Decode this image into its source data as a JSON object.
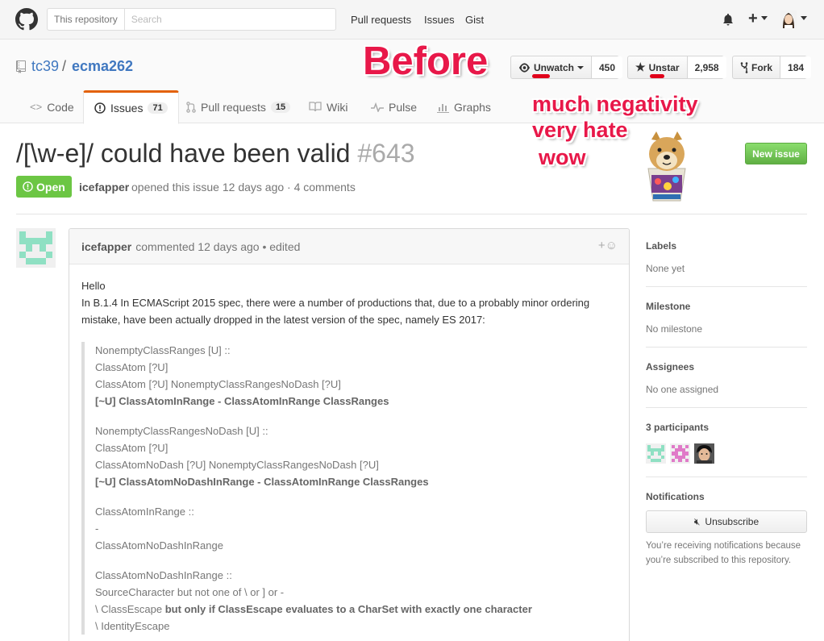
{
  "header": {
    "search_scope": "This repository",
    "search_placeholder": "Search",
    "nav": [
      "Pull requests",
      "Issues",
      "Gist"
    ]
  },
  "repo": {
    "owner": "tc39",
    "sep": "/",
    "name": "ecma262",
    "watch_label": "Unwatch",
    "watch_count": "450",
    "star_label": "Unstar",
    "star_count": "2,958",
    "fork_label": "Fork",
    "fork_count": "184"
  },
  "tabs": [
    {
      "label": "Code"
    },
    {
      "label": "Issues",
      "count": "71"
    },
    {
      "label": "Pull requests",
      "count": "15"
    },
    {
      "label": "Wiki"
    },
    {
      "label": "Pulse"
    },
    {
      "label": "Graphs"
    }
  ],
  "meme": {
    "before": "Before",
    "line1": "much negativity",
    "line2": "very hate",
    "line3": "wow"
  },
  "issue": {
    "title": "/[\\w-e]/ could have been valid",
    "number": "#643",
    "state": "Open",
    "author": "icefapper",
    "meta": "opened this issue 12 days ago · 4 comments",
    "new_issue": "New issue"
  },
  "comment": {
    "author": "icefapper",
    "meta": "commented 12 days ago • edited",
    "hello": "Hello",
    "intro": "In B.1.4 In ECMAScript 2015 spec, there were a number of productions that, due to a probably minor ordering mistake, have been actually dropped in the latest version of the spec, namely ES 2017:",
    "blocks": [
      {
        "lines": [
          "NonemptyClassRanges [U] ::",
          "ClassAtom [?U]",
          "ClassAtom [?U] NonemptyClassRangesNoDash [?U]"
        ],
        "bold": "[~U] ClassAtomInRange - ClassAtomInRange ClassRanges"
      },
      {
        "lines": [
          "NonemptyClassRangesNoDash [U] ::",
          "ClassAtom [?U]",
          "ClassAtomNoDash [?U] NonemptyClassRangesNoDash [?U]"
        ],
        "bold": "[~U] ClassAtomNoDashInRange - ClassAtomInRange ClassRanges"
      },
      {
        "lines": [
          "ClassAtomInRange ::",
          "-",
          "ClassAtomNoDashInRange"
        ]
      },
      {
        "lines": [
          "ClassAtomNoDashInRange ::",
          "SourceCharacter but not one of \\ or ] or -"
        ],
        "mixed_pre": "\\ ClassEscape ",
        "mixed_bold": "but only if ClassEscape evaluates to a CharSet with exactly one character",
        "last": "\\ IdentityEscape"
      }
    ]
  },
  "sidebar": {
    "labels_title": "Labels",
    "labels_val": "None yet",
    "milestone_title": "Milestone",
    "milestone_val": "No milestone",
    "assignees_title": "Assignees",
    "assignees_val": "No one assigned",
    "participants_title": "3 participants",
    "notifications_title": "Notifications",
    "unsubscribe": "Unsubscribe",
    "notify_text": "You’re receiving notifications because you’re subscribed to this repository."
  }
}
